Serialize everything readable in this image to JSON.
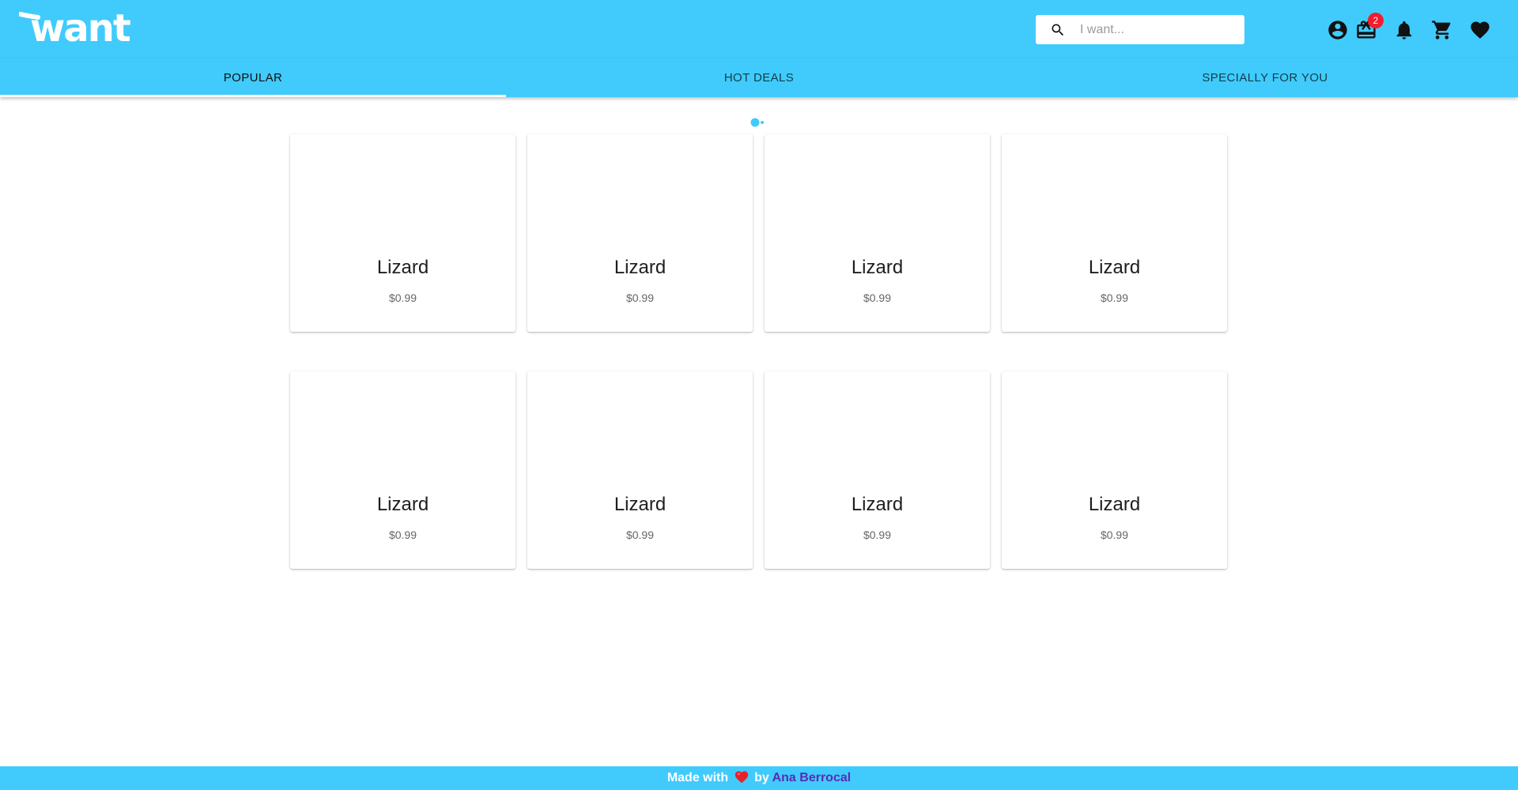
{
  "app": {
    "logo_text": "want"
  },
  "search": {
    "placeholder": "I want..."
  },
  "header": {
    "actions": [
      {
        "name": "account-circle-icon"
      },
      {
        "name": "gift-icon",
        "badge": "2"
      },
      {
        "name": "bell-icon"
      },
      {
        "name": "cart-icon"
      },
      {
        "name": "heart-icon"
      }
    ]
  },
  "tabs": [
    {
      "label": "Popular",
      "active": true
    },
    {
      "label": "Hot Deals",
      "active": false
    },
    {
      "label": "Specially For You",
      "active": false
    }
  ],
  "products": [
    {
      "title": "Lizard",
      "price": "$0.99"
    },
    {
      "title": "Lizard",
      "price": "$0.99"
    },
    {
      "title": "Lizard",
      "price": "$0.99"
    },
    {
      "title": "Lizard",
      "price": "$0.99"
    },
    {
      "title": "Lizard",
      "price": "$0.99"
    },
    {
      "title": "Lizard",
      "price": "$0.99"
    },
    {
      "title": "Lizard",
      "price": "$0.99"
    },
    {
      "title": "Lizard",
      "price": "$0.99"
    }
  ],
  "footer": {
    "prefix": "Made with",
    "heart_icon": "heart-emoji",
    "by": "by",
    "author": "Ana Berrocal"
  },
  "colors": {
    "brand": "#40cbfc",
    "badge": "#f41b2c",
    "footer_link": "#5b2bb5"
  }
}
